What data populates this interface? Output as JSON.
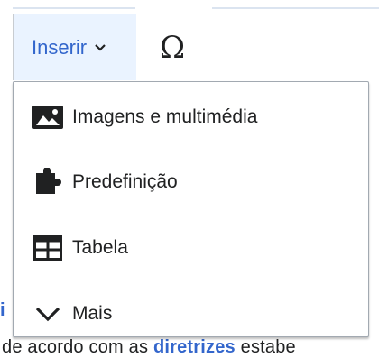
{
  "toolbar": {
    "insert_label": "Inserir",
    "special_char_symbol": "Ω"
  },
  "menu": {
    "items": [
      {
        "label": "Imagens e multimédia",
        "icon": "image-icon"
      },
      {
        "label": "Predefinição",
        "icon": "puzzle-icon"
      },
      {
        "label": "Tabela",
        "icon": "table-icon"
      },
      {
        "label": "Mais",
        "icon": "chevron-down-icon"
      }
    ]
  },
  "background": {
    "left_fragment": "i",
    "text_before_link": "de acordo com as ",
    "link_text": "diretrizes",
    "text_after_link": " estabe"
  },
  "colors": {
    "accent": "#3366cc",
    "active_bg": "#eaf3ff",
    "text": "#202122",
    "border": "#a2a9b1"
  }
}
